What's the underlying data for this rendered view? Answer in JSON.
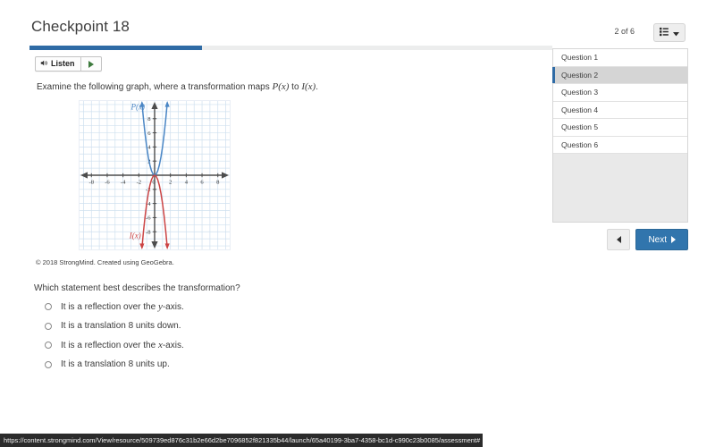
{
  "header": {
    "title": "Checkpoint 18",
    "progress_percent": 33,
    "progress_fill_color": "#2f6ba5"
  },
  "toolbar": {
    "listen_label": "Listen",
    "speaker_icon": "speaker-icon",
    "play_icon": "play-icon"
  },
  "content": {
    "prompt_prefix": "Examine the following graph, where a transformation maps ",
    "prompt_fn1": "P(x)",
    "prompt_mid": " to ",
    "prompt_fn2": "I(x)",
    "prompt_suffix": ".",
    "attribution": "© 2018 StrongMind. Created using GeoGebra.",
    "question": "Which statement best describes the transformation?",
    "options": [
      {
        "id": "opt-a",
        "text_before": "It is a reflection over the ",
        "var": "y",
        "text_after": "-axis.",
        "selected": false
      },
      {
        "id": "opt-b",
        "text_before": "It is a translation 8 units down.",
        "var": "",
        "text_after": "",
        "selected": false
      },
      {
        "id": "opt-c",
        "text_before": "It is a reflection over the ",
        "var": "x",
        "text_after": "-axis.",
        "selected": false
      },
      {
        "id": "opt-d",
        "text_before": "It is a translation 8 units up.",
        "var": "",
        "text_after": "",
        "selected": false
      }
    ]
  },
  "chart_data": {
    "type": "line",
    "title": "",
    "xlabel": "",
    "ylabel": "",
    "xlim": [
      -9.5,
      9.5
    ],
    "ylim": [
      -10.5,
      10.5
    ],
    "xticks": [
      -8,
      -6,
      -4,
      -2,
      0,
      2,
      4,
      6,
      8
    ],
    "yticks": [
      8,
      6,
      4,
      2,
      -2,
      -4,
      -6,
      -8
    ],
    "grid": true,
    "grid_color": "#cfe0ef",
    "axis_color": "#4d4d4d",
    "legend_position": "inline-labels",
    "series": [
      {
        "name": "P(x)",
        "label": "P(x)",
        "color": "#4a86c5",
        "equation": "y = 4x^2",
        "points": [
          [
            -1.6,
            10.24
          ],
          [
            -1.4,
            7.84
          ],
          [
            -1.2,
            5.76
          ],
          [
            -1.0,
            4.0
          ],
          [
            -0.8,
            2.56
          ],
          [
            -0.6,
            1.44
          ],
          [
            -0.4,
            0.64
          ],
          [
            -0.2,
            0.16
          ],
          [
            0,
            0
          ],
          [
            0.2,
            0.16
          ],
          [
            0.4,
            0.64
          ],
          [
            0.6,
            1.44
          ],
          [
            0.8,
            2.56
          ],
          [
            1.0,
            4.0
          ],
          [
            1.2,
            5.76
          ],
          [
            1.4,
            7.84
          ],
          [
            1.6,
            10.24
          ]
        ]
      },
      {
        "name": "I(x)",
        "label": "I(x)",
        "color": "#cc4444",
        "equation": "y = -4x^2",
        "points": [
          [
            -1.6,
            -10.24
          ],
          [
            -1.4,
            -7.84
          ],
          [
            -1.2,
            -5.76
          ],
          [
            -1.0,
            -4.0
          ],
          [
            -0.8,
            -2.56
          ],
          [
            -0.6,
            -1.44
          ],
          [
            -0.4,
            -0.64
          ],
          [
            -0.2,
            -0.16
          ],
          [
            0,
            0
          ],
          [
            0.2,
            -0.16
          ],
          [
            0.4,
            -0.64
          ],
          [
            0.6,
            -1.44
          ],
          [
            0.8,
            -2.56
          ],
          [
            1.0,
            -4.0
          ],
          [
            1.2,
            -5.76
          ],
          [
            1.4,
            -7.84
          ],
          [
            1.6,
            -10.24
          ]
        ]
      }
    ]
  },
  "sidebar": {
    "counter": "2 of 6",
    "menu_icon": "list-menu-icon",
    "questions": [
      {
        "label": "Question 1",
        "selected": false
      },
      {
        "label": "Question 2",
        "selected": true
      },
      {
        "label": "Question 3",
        "selected": false
      },
      {
        "label": "Question 4",
        "selected": false
      },
      {
        "label": "Question 5",
        "selected": false
      },
      {
        "label": "Question 6",
        "selected": false
      }
    ],
    "prev_icon": "triangle-left-icon",
    "next_label": "Next",
    "next_icon": "triangle-right-icon",
    "next_color": "#3175ad"
  },
  "statusbar": {
    "url": "https://content.strongmind.com/View/resource/509739ed876c31b2e66d2be7096852f821335b44/launch/65a40199-3ba7-4358-bc1d-c990c23b0085/assessment#"
  }
}
